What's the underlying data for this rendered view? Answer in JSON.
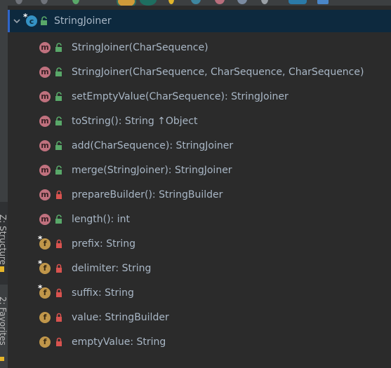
{
  "tool_windows": [
    {
      "label": "Z: Structure",
      "active": true
    },
    {
      "label": "2: Favorites",
      "active": false
    }
  ],
  "tree": {
    "root": {
      "label": "StringJoiner",
      "icon": "class-icon",
      "visibility": "public"
    },
    "members": [
      {
        "kind": "method",
        "label": "StringJoiner(CharSequence)",
        "visibility": "public"
      },
      {
        "kind": "method",
        "label": "StringJoiner(CharSequence, CharSequence, CharSequence)",
        "visibility": "public"
      },
      {
        "kind": "method",
        "label": "setEmptyValue(CharSequence): StringJoiner",
        "visibility": "public"
      },
      {
        "kind": "method",
        "label": "toString(): String ↑Object",
        "visibility": "public"
      },
      {
        "kind": "method",
        "label": "add(CharSequence): StringJoiner",
        "visibility": "public"
      },
      {
        "kind": "method",
        "label": "merge(StringJoiner): StringJoiner",
        "visibility": "public"
      },
      {
        "kind": "method",
        "label": "prepareBuilder(): StringBuilder",
        "visibility": "private"
      },
      {
        "kind": "method",
        "label": "length(): int",
        "visibility": "public"
      },
      {
        "kind": "field",
        "label": "prefix: String",
        "visibility": "private",
        "final": true
      },
      {
        "kind": "field",
        "label": "delimiter: String",
        "visibility": "private",
        "final": true
      },
      {
        "kind": "field",
        "label": "suffix: String",
        "visibility": "private",
        "final": true
      },
      {
        "kind": "field",
        "label": "value: StringBuilder",
        "visibility": "private",
        "final": false
      },
      {
        "kind": "field",
        "label": "emptyValue: String",
        "visibility": "private",
        "final": false
      }
    ]
  },
  "icon_letters": {
    "method": "m",
    "field": "f"
  },
  "colors": {
    "background": "#2b2b2b",
    "selection": "#0d293e",
    "method_icon": "#c0717e",
    "field_icon": "#c0964a",
    "public_lock": "#59a869",
    "private_lock": "#d9534f",
    "text": "#a9b7c6"
  }
}
